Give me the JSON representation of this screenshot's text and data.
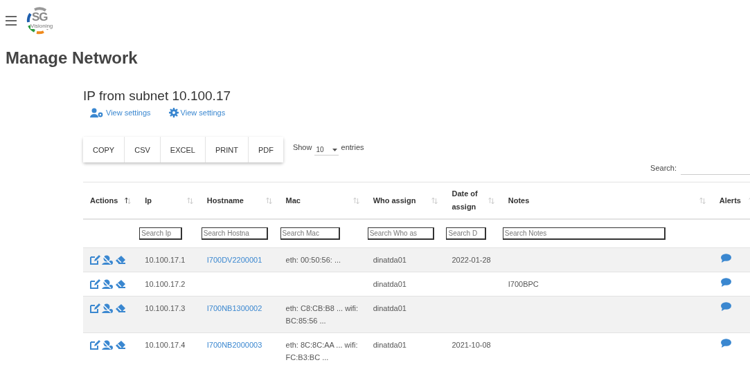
{
  "logo": {
    "initials": "SG",
    "tagline": "Visioning"
  },
  "page_title": "Manage Network",
  "subtitle": "IP from subnet 10.100.17",
  "view_links": [
    {
      "kind": "users",
      "label": "View settings"
    },
    {
      "kind": "gear",
      "label": "View settings"
    }
  ],
  "export_buttons": [
    "COPY",
    "CSV",
    "EXCEL",
    "PRINT",
    "PDF"
  ],
  "length_menu": {
    "prefix": "Show",
    "value": "10",
    "suffix": "entries"
  },
  "search": {
    "label": "Search:"
  },
  "table": {
    "columns": [
      {
        "label": "Actions",
        "sorted": true
      },
      {
        "label": "Ip",
        "sorted": false,
        "placeholder": "Search Ip"
      },
      {
        "label": "Hostname",
        "sorted": false,
        "placeholder": "Search Hostna"
      },
      {
        "label": "Mac",
        "sorted": false,
        "placeholder": "Search Mac"
      },
      {
        "label": "Who assign",
        "sorted": false,
        "placeholder": "Search Who as"
      },
      {
        "label": "Date of assign",
        "sorted": false,
        "placeholder": "Search D"
      },
      {
        "label": "Notes",
        "sorted": false,
        "placeholder": "Search Notes"
      },
      {
        "label": "Alerts",
        "sorted": false
      }
    ],
    "rows": [
      {
        "ip": "10.100.17.1",
        "hostname": "I700DV2200001",
        "mac": "eth: 00:50:56: ...",
        "who": "dinatda01",
        "date": "2022-01-28"
      },
      {
        "ip": "10.100.17.2",
        "who": "dinatda01",
        "notes": "I700BPC"
      },
      {
        "ip": "10.100.17.3",
        "hostname": "I700NB1300002",
        "mac": "eth: C8:CB:B8 ... wifi: BC:85:56 ...",
        "who": "dinatda01"
      },
      {
        "ip": "10.100.17.4",
        "hostname": "I700NB2000003",
        "mac": "eth: 8C:8C:AA ... wifi: FC:B3:BC ...",
        "who": "dinatda01",
        "date": "2021-10-08"
      }
    ]
  }
}
